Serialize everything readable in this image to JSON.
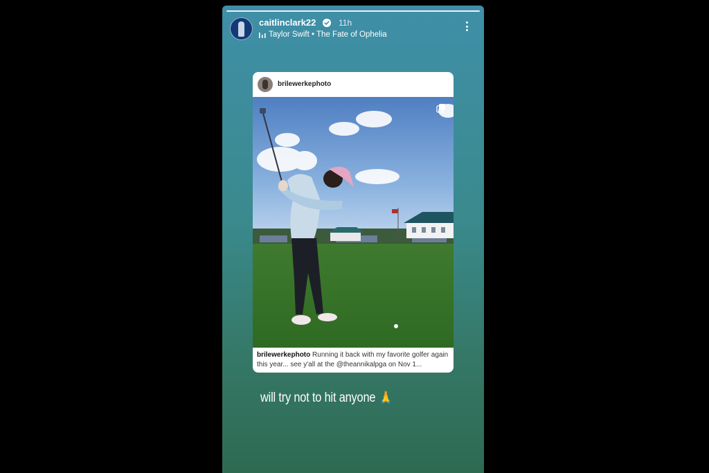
{
  "header": {
    "username": "caitlinclark22",
    "time": "11h",
    "music_artist": "Taylor Swift",
    "music_separator": "•",
    "music_song": "The Fate of Ophelia"
  },
  "post": {
    "username": "brilewerkephoto",
    "caption_user": "brilewerkephoto",
    "caption_text": "Running it back with my favorite golfer again this year... see y'all at the @theannikalpga on Nov 1..."
  },
  "story_text": "will try not to hit anyone",
  "icons": {
    "verified": "verified-badge-icon",
    "music": "music-bars-icon",
    "more": "more-vertical-icon",
    "multi": "carousel-multi-icon",
    "emoji": "🙏"
  },
  "colors": {
    "background": "#000000",
    "story_gradient_top": "#3f8fa8",
    "story_gradient_bottom": "#2e6a52",
    "verified": "#3897f0"
  }
}
